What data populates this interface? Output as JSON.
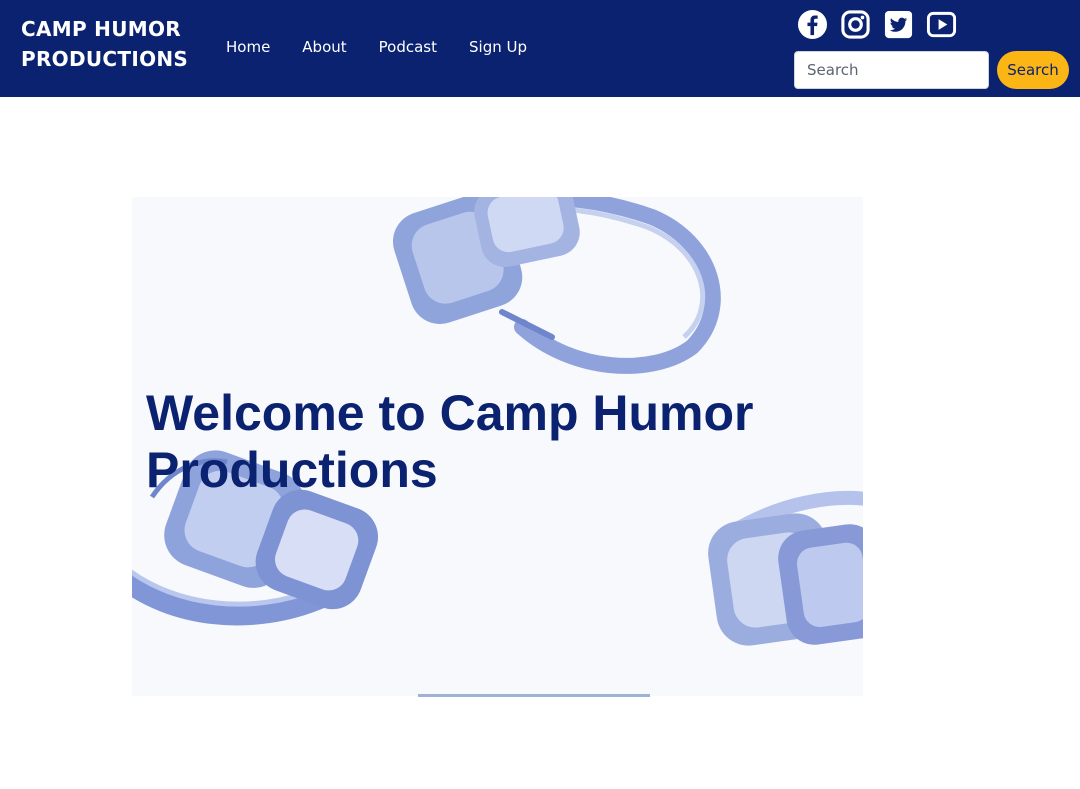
{
  "brand": {
    "line1": "CAMP HUMOR",
    "line2": "PRODUCTIONS"
  },
  "nav": {
    "items": [
      {
        "label": "Home"
      },
      {
        "label": "About"
      },
      {
        "label": "Podcast"
      },
      {
        "label": "Sign Up"
      }
    ]
  },
  "social": {
    "icons": [
      "facebook-icon",
      "instagram-icon",
      "twitter-icon",
      "youtube-icon"
    ]
  },
  "search": {
    "placeholder": "Search",
    "value": "",
    "button_label": "Search"
  },
  "hero": {
    "title": "Welcome to Camp Humor Productions",
    "image": "headphones-image"
  },
  "colors": {
    "navbar": "#0b2270",
    "accent": "#fbb514",
    "title": "#0b2270",
    "image_tint": "#7f95d4"
  }
}
